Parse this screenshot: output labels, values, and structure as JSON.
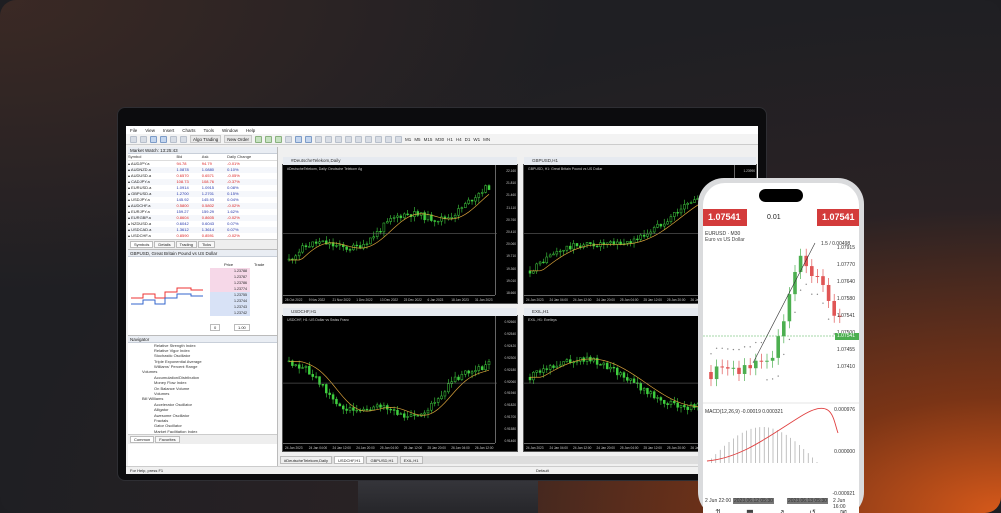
{
  "menu": [
    "File",
    "View",
    "Insert",
    "Charts",
    "Tools",
    "Window",
    "Help"
  ],
  "toolbar": {
    "algo_label": "Algo Trading",
    "new_order_label": "New Order",
    "timeframes": [
      "M1",
      "M5",
      "M15",
      "M30",
      "H1",
      "H4",
      "D1",
      "W1",
      "MN"
    ]
  },
  "market_watch": {
    "title": "Market Watch: 13:25:43",
    "columns": [
      "Symbol",
      "Bid",
      "Ask",
      "Daily Change"
    ],
    "rows": [
      [
        "AUDJPY.a",
        "94.78",
        "94.79",
        "-0.01%"
      ],
      [
        "AUDNZD.a",
        "1.0878",
        "1.0880",
        "0.10%"
      ],
      [
        "AUDUSD.a",
        "0.6570",
        "0.6571",
        "-0.05%"
      ],
      [
        "CADJPY.a",
        "108.73",
        "108.76",
        "-0.37%"
      ],
      [
        "EURUSD.a",
        "1.0914",
        "1.0915",
        "0.08%"
      ],
      [
        "GBPUSD.a",
        "1.2700",
        "1.2701",
        "0.15%"
      ],
      [
        "USDJPY.a",
        "145.92",
        "145.93",
        "0.04%"
      ],
      [
        "AUDCHF.a",
        "0.5800",
        "0.5802",
        "-0.02%"
      ],
      [
        "EURJPY.a",
        "159.27",
        "159.29",
        "1.62%"
      ],
      [
        "EURGBP.a",
        "0.8604",
        "0.8605",
        "-0.02%"
      ],
      [
        "NZDUSD.a",
        "0.6042",
        "0.6043",
        "0.07%"
      ],
      [
        "USDCAD.a",
        "1.3612",
        "1.3614",
        "0.07%"
      ],
      [
        "USDCHF.a",
        "0.8590",
        "0.8591",
        "-0.02%"
      ]
    ],
    "tabs": [
      "Symbols",
      "Details",
      "Trading",
      "Ticks"
    ]
  },
  "depth": {
    "title": "GBPUSD, Great Britain Pound vs US Dollar",
    "columns": [
      "Price",
      "Trade"
    ],
    "prices": [
      "1.23788",
      "1.23787",
      "1.23786",
      "1.23774",
      "1.23755",
      "1.23744",
      "1.23743",
      "1.23742"
    ],
    "qty1": "0",
    "qty2": "1.00"
  },
  "navigator": {
    "title": "Navigator",
    "items": [
      {
        "label": "Relative Strength Index",
        "group": false
      },
      {
        "label": "Relative Vigor Index",
        "group": false
      },
      {
        "label": "Stochastic Oscillator",
        "group": false
      },
      {
        "label": "Triple Exponential Average",
        "group": false
      },
      {
        "label": "Williams' Percent Range",
        "group": false
      },
      {
        "label": "Volumes",
        "group": true
      },
      {
        "label": "Accumulation/Distribution",
        "group": false
      },
      {
        "label": "Money Flow Index",
        "group": false
      },
      {
        "label": "On Balance Volume",
        "group": false
      },
      {
        "label": "Volumes",
        "group": false
      },
      {
        "label": "Bill Williams",
        "group": true
      },
      {
        "label": "Accelerator Oscillator",
        "group": false
      },
      {
        "label": "Alligator",
        "group": false
      },
      {
        "label": "Awesome Oscillator",
        "group": false
      },
      {
        "label": "Fractals",
        "group": false
      },
      {
        "label": "Gator Oscillator",
        "group": false
      },
      {
        "label": "Market Facilitation Index",
        "group": false
      }
    ],
    "tabs": [
      "Common",
      "Favorites"
    ]
  },
  "charts": [
    {
      "title": "#DeutscheTelekom,Daily",
      "symbol": "#DeutscheTelekom, Daily: Deutsche Telekom Ag",
      "prices": [
        "22.160",
        "21.810",
        "21.460",
        "21.110",
        "20.760",
        "20.410",
        "20.060",
        "19.710",
        "19.360",
        "19.010",
        "18.660"
      ],
      "dates": [
        "28 Oct 2022",
        "9 Nov 2022",
        "21 Nov 2022",
        "1 Dec 2022",
        "13 Dec 2022",
        "23 Dec 2022",
        "6 Jan 2023",
        "18 Jan 2023",
        "31 Jan 2023"
      ]
    },
    {
      "title": "GBPUSD,H1",
      "symbol": "GBPUSD, H1: Great Britain Pound vs US Dollar",
      "prices": [
        "1.23990",
        "1.23810",
        "1.23630",
        "1.23450",
        "1.23270",
        "1.23090",
        "1.22910",
        "1.22730",
        "1.22550",
        "1.22370",
        "1.22190"
      ],
      "dates": [
        "24 Jan 2023",
        "24 Jan 04:00",
        "24 Jan 12:00",
        "24 Jan 20:00",
        "25 Jan 04:00",
        "25 Jan 12:00",
        "25 Jan 20:00",
        "26 Jan 04:00",
        "26 Jan 12:00"
      ]
    },
    {
      "title": "USDCHF,H1",
      "symbol": "USDCHF, H1: US Dollar vs Swiss Franc",
      "prices": [
        "0.92660",
        "0.92540",
        "0.92420",
        "0.92300",
        "0.92180",
        "0.92060",
        "0.91940",
        "0.91820",
        "0.91700",
        "0.91580",
        "0.91460"
      ],
      "dates": [
        "24 Jan 2023",
        "24 Jan 04:00",
        "24 Jan 12:00",
        "24 Jan 20:00",
        "25 Jan 04:00",
        "25 Jan 12:00",
        "25 Jan 20:00",
        "26 Jan 04:00",
        "26 Jan 12:00"
      ]
    },
    {
      "title": "EXIL,H1",
      "symbol": "EXIL, H1: Exelixys",
      "prices": [
        "19.820",
        "19.690",
        "19.560",
        "19.430",
        "19.300",
        "19.170",
        "19.040",
        "18.910",
        "18.780",
        "18.650",
        "18.520"
      ],
      "dates": [
        "24 Jan 2023",
        "24 Jan 04:00",
        "24 Jan 12:00",
        "24 Jan 20:00",
        "25 Jan 04:00",
        "25 Jan 12:00",
        "25 Jan 20:00",
        "26 Jan 04:00",
        "26 Jan 12:00"
      ]
    }
  ],
  "chart_tabs": [
    "#DeutscheTelekom,Daily",
    "USDCHF,H1",
    "GBPUSD,H1",
    "EXIL,H1"
  ],
  "status": {
    "help": "For Help, press F1",
    "profile": "Default"
  },
  "phone": {
    "sell_price": "1.07541",
    "buy_price": "1.07541",
    "lot": "0.01",
    "symbol": "EURUSD · M30",
    "description": "Euro vs US Dollar",
    "overlay": "1.5 / 0.00498",
    "prices": [
      "1.07915",
      "1.07770",
      "1.07640",
      "1.07580",
      "1.07541",
      "1.07500",
      "1.07455",
      "1.07410"
    ],
    "current_price": "1.07541",
    "macd_label": "MACD(12,26,9) -0.00019 0.000321",
    "macd_levels": [
      "0.000976",
      "0.000000",
      "-0.000921"
    ],
    "dates": [
      "2 Jun 22:00",
      "2023.06.12 05:30",
      "2023.06.13 05:30",
      "2 Jun 16:00"
    ]
  }
}
